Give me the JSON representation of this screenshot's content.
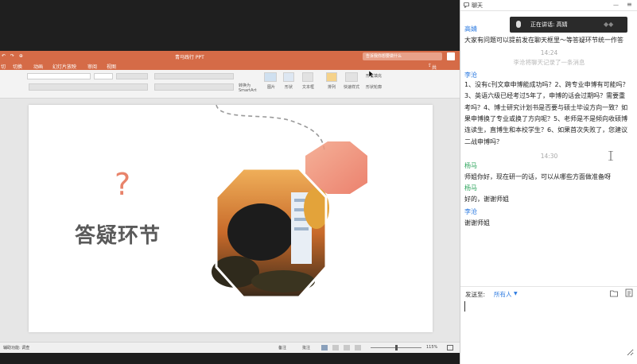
{
  "ppt": {
    "doc_title": "青马践行 PPT",
    "search_placeholder": "告诉我你想要做什么",
    "menu": [
      "切",
      "切换",
      "动画",
      "幻灯片放映",
      "审阅",
      "视图"
    ],
    "share": "共享",
    "ribbon": {
      "format": "格式",
      "reset": "重置",
      "section": "节",
      "convert": "转换为\nSmartArt",
      "picture": "图片",
      "shape": "形状",
      "textbox": "文本框",
      "arrange": "排列",
      "quickstyle": "快速样式",
      "shape_fill": "形状填充",
      "shape_outline": "形状轮廓"
    },
    "slide": {
      "question_mark": "?",
      "title": "答疑环节"
    },
    "status": {
      "left": "辅助功能: 调查",
      "notes": "备注",
      "comments": "批注",
      "zoom": "115%"
    }
  },
  "chat": {
    "title": "聊天",
    "speaking_label": "正在讲话: 高婧",
    "messages": [
      {
        "type": "sender",
        "name": "高婧",
        "color": "blue"
      },
      {
        "type": "line",
        "text": "大家有问题可以提前发在聊天框里～等答疑环节统一作答"
      },
      {
        "type": "time",
        "text": "14:24"
      },
      {
        "type": "sys",
        "text": "李沧将聊天记录了一条消息"
      },
      {
        "type": "sender",
        "name": "李沧",
        "color": "blue"
      },
      {
        "type": "line",
        "text": "1、没有c刊文章申博能成功吗？2、跨专业申博有可能吗？"
      },
      {
        "type": "line",
        "text": "3、英语六级已经考过5年了，申博的话会过期吗？需要重"
      },
      {
        "type": "line",
        "text": "考吗？4、博士研究计划书是否要与硕士毕设方向一致？如"
      },
      {
        "type": "line",
        "text": "果申博换了专业或换了方向呢？5、老师是不是倾向收硕博"
      },
      {
        "type": "line",
        "text": "连读生，直博生和本校学生？6、如果首次失败了，您建议"
      },
      {
        "type": "line",
        "text": "二战申博吗？"
      },
      {
        "type": "time",
        "text": "14:30"
      },
      {
        "type": "sender",
        "name": "杨马",
        "color": "green"
      },
      {
        "type": "line",
        "text": "师姐你好，现在研一的话，可以从哪些方面做准备呀"
      },
      {
        "type": "sender",
        "name": "杨马",
        "color": "green"
      },
      {
        "type": "line",
        "text": "好的，谢谢师姐"
      },
      {
        "type": "sender",
        "name": "李沧",
        "color": "blue"
      },
      {
        "type": "line",
        "text": "谢谢师姐"
      }
    ],
    "send_to_label": "发送至:",
    "send_to_value": "所有人",
    "compose_placeholder": ""
  },
  "colors": {
    "ppt_accent": "#d56b47",
    "chat_blue": "#2e7be0",
    "chat_green": "#2aa35a",
    "slide_orange": "#e8836a"
  }
}
